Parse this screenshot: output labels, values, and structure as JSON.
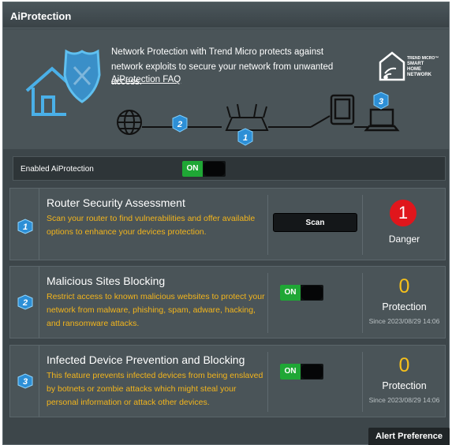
{
  "page": {
    "title": "AiProtection"
  },
  "hero": {
    "description": "Network Protection with Trend Micro protects against network exploits to secure your network from unwanted access.",
    "faq_link": "AiProtection FAQ",
    "logo_lines": [
      "TREND MICRO™",
      "SMART",
      "HOME",
      "NETWORK"
    ],
    "diagram_badges": [
      "2",
      "1",
      "3"
    ]
  },
  "enable": {
    "label": "Enabled AiProtection",
    "toggle_text": "ON"
  },
  "cards": [
    {
      "badge": "1",
      "title": "Router Security Assessment",
      "description": "Scan your router to find vulnerabilities and offer available options to enhance your devices protection.",
      "button": "Scan",
      "status_count": "1",
      "status_label": "Danger"
    },
    {
      "badge": "2",
      "title": "Malicious Sites Blocking",
      "description": "Restrict access to known malicious websites to protect your network from malware, phishing, spam, adware, hacking, and ransomware attacks.",
      "toggle_text": "ON",
      "count": "0",
      "count_label": "Protection",
      "since": "Since 2023/08/29 14:06"
    },
    {
      "badge": "3",
      "title": "Infected Device Prevention and Blocking",
      "description": "This feature prevents infected devices from being enslaved by botnets or zombie attacks which might steal your personal information or attack other devices.",
      "toggle_text": "ON",
      "count": "0",
      "count_label": "Protection",
      "since": "Since 2023/08/29 14:06"
    }
  ],
  "footer": {
    "alert_preference": "Alert Preference"
  },
  "colors": {
    "accent_yellow": "#f3b51c",
    "toggle_green": "#1fa735",
    "danger_red": "#e0161c",
    "badge_blue": "#2d8fd6"
  }
}
